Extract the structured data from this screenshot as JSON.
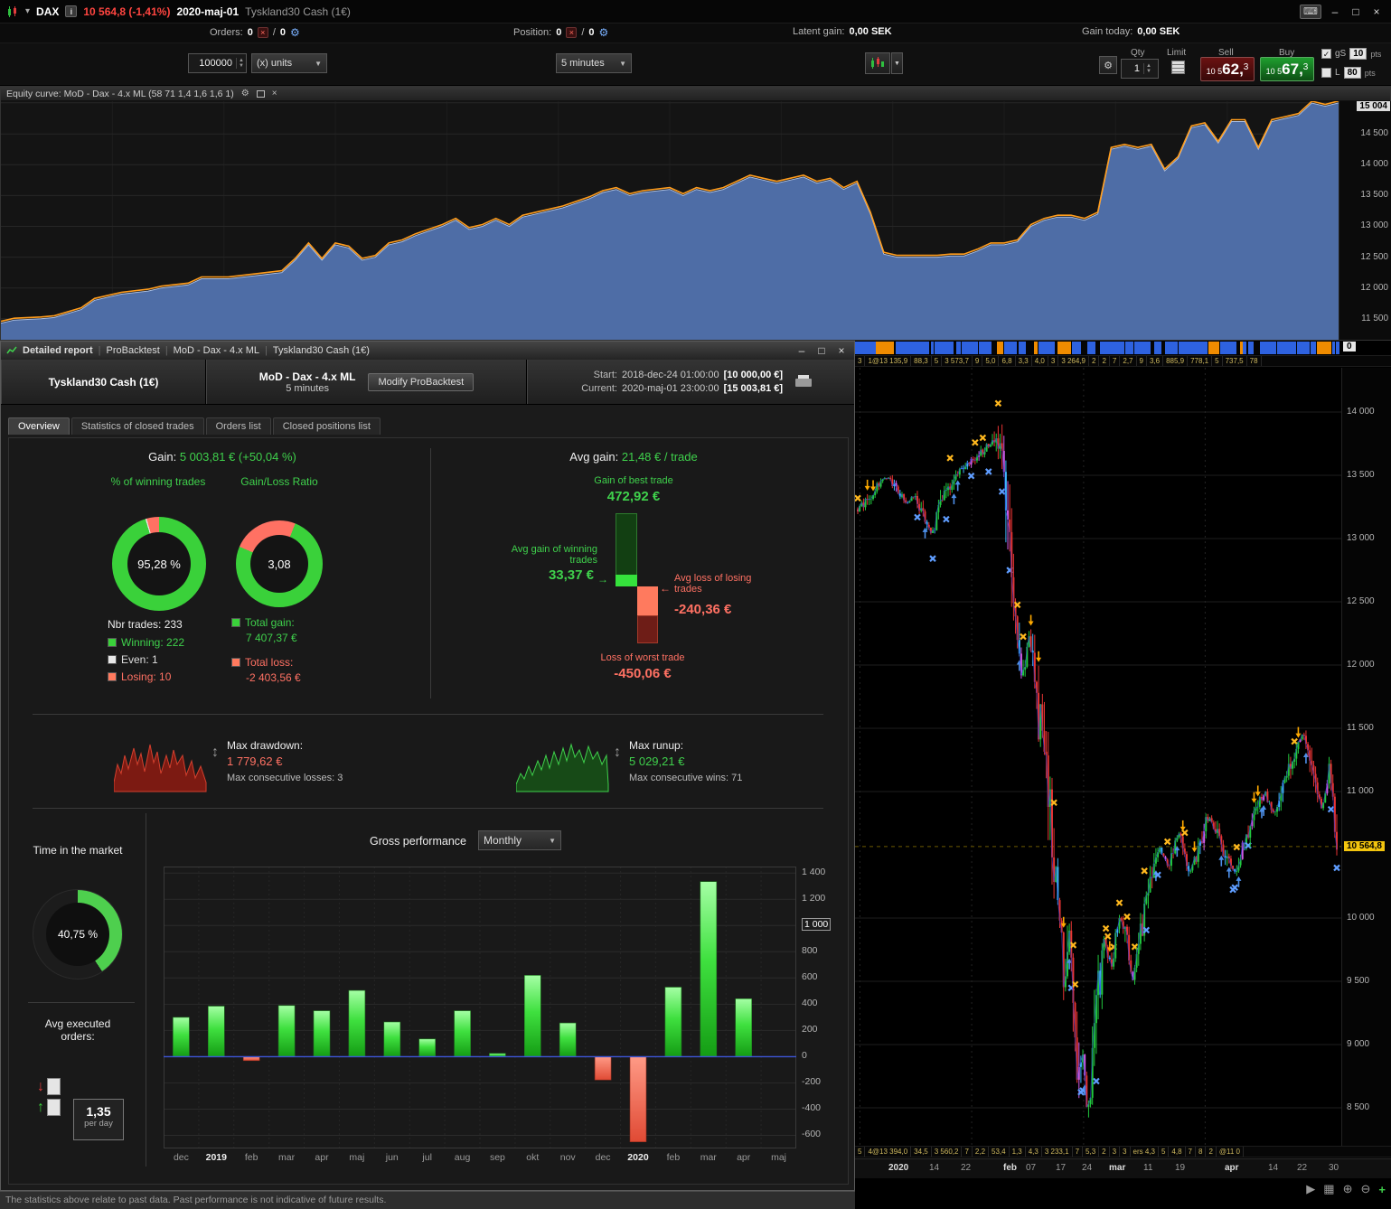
{
  "titlebar": {
    "instrument_short": "DAX",
    "price_change": "10 564,8 (-1,41%)",
    "date": "2020-maj-01",
    "instrument_full": "Tyskland30 Cash (1€)"
  },
  "toolbar": {
    "orders_label": "Orders:",
    "orders_count": "0",
    "orders_count2": "0",
    "position_label": "Position:",
    "position_count": "0",
    "position_count2": "0",
    "latent_gain_label": "Latent gain:",
    "latent_gain_value": "0,00 SEK",
    "gain_today_label": "Gain today:",
    "gain_today_value": "0,00 SEK",
    "units_value": "100000",
    "units_suffix": "(x) units",
    "timeframe": "5 minutes",
    "qty_label": "Qty",
    "qty_value": "1",
    "limit_label": "Limit",
    "sell_label": "Sell",
    "buy_label": "Buy",
    "sell_price_prefix": "10 5",
    "sell_price_main": "62,",
    "sell_price_sup": "3",
    "buy_price_prefix": "10 5",
    "buy_price_main": "67,",
    "buy_price_sup": "3",
    "gs_label": "gS",
    "gs_value": "10",
    "gs_unit": "pts",
    "l_label": "L",
    "l_value": "80",
    "l_unit": "pts"
  },
  "equity_panel": {
    "title": "Equity curve: MoD - Dax - 4.x ML (58 71 1,4 1,6 1,6 1)"
  },
  "report": {
    "window_tabs": [
      "Detailed report",
      "ProBacktest",
      "MoD - Dax - 4.x ML",
      "Tyskland30 Cash (1€)"
    ],
    "header": {
      "instrument": "Tyskland30 Cash (1€)",
      "strategy": "MoD - Dax - 4.x ML",
      "timeframe": "5 minutes",
      "modify_button": "Modify ProBacktest",
      "start_label": "Start:",
      "start_time": "2018-dec-24 01:00:00",
      "start_value": "[10 000,00 €]",
      "current_label": "Current:",
      "current_time": "2020-maj-01 23:00:00",
      "current_value": "[15 003,81 €]"
    },
    "tabs": [
      "Overview",
      "Statistics of closed trades",
      "Orders list",
      "Closed positions list"
    ],
    "active_tab": "Overview",
    "overview": {
      "gain_label": "Gain:",
      "gain_value": "5 003,81 € (+50,04 %)",
      "winning_trades_label": "% of winning trades",
      "winning_trades_pct": "95,28 %",
      "gain_loss_ratio_label": "Gain/Loss Ratio",
      "gain_loss_ratio": "3,08",
      "nbr_trades_label": "Nbr trades:",
      "nbr_trades": "233",
      "winning_label": "Winning:",
      "winning": "222",
      "even_label": "Even:",
      "even": "1",
      "losing_label": "Losing:",
      "losing": "10",
      "total_gain_label": "Total gain:",
      "total_gain": "7 407,37 €",
      "total_loss_label": "Total loss:",
      "total_loss": "-2 403,56 €",
      "avg_gain_label": "Avg gain:",
      "avg_gain": "21,48 € / trade",
      "best_trade_label": "Gain of best trade",
      "best_trade": "472,92 €",
      "avg_win_label": "Avg gain of winning trades",
      "avg_win": "33,37 €",
      "avg_loss_label": "Avg loss of losing trades",
      "avg_loss": "-240,36 €",
      "worst_trade_label": "Loss of worst trade",
      "worst_trade": "-450,06 €",
      "max_drawdown_label": "Max drawdown:",
      "max_drawdown": "1 779,62 €",
      "max_consec_losses": "Max consecutive losses: 3",
      "max_runup_label": "Max runup:",
      "max_runup": "5 029,21 €",
      "max_consec_wins": "Max consecutive wins: 71",
      "time_in_market_label": "Time in the market",
      "time_in_market": "40,75 %",
      "avg_orders_label": "Avg executed orders:",
      "avg_orders": "1,35",
      "avg_orders_unit": "per day",
      "gross_perf_label": "Gross performance",
      "gross_perf_period": "Monthly"
    },
    "status_bar": "The statistics above relate to past data. Past performance is not indicative of future results."
  },
  "price_panel": {
    "current_value_badge": "0",
    "strip_colors": {
      "long": "#2e62e0",
      "signal": "#f08c00"
    },
    "ticker_top": [
      "3",
      "1@13 135,9",
      "88,3",
      "5",
      "3 573,7",
      "9",
      "5,0",
      "6,8",
      "3,3",
      "4,0",
      "3",
      "3 264,9",
      "2",
      "2",
      "7",
      "2,7",
      "9",
      "3,6",
      "885,9",
      "778,1",
      "5",
      "737,5",
      "78"
    ],
    "ticker_bottom": [
      "5",
      "4@13 394,0",
      "34,5",
      "3 560,2",
      "7",
      "2,2",
      "53,4",
      "1,3",
      "4,3",
      "3 233,1",
      "7",
      "5,3",
      "2",
      "3",
      "3",
      "ers 4,3",
      "5",
      "4,8",
      "7",
      "8",
      "2",
      "@11 0"
    ]
  },
  "chart_data": [
    {
      "id": "equity_curve",
      "type": "area",
      "title": "Equity curve: MoD - Dax - 4.x ML (58 71 1,4 1,6 1,6 1)",
      "ylim": [
        11160,
        15030
      ],
      "y_ticks": [
        {
          "label": "15 004",
          "value": 15004,
          "highlight": true
        },
        {
          "label": "14 500",
          "value": 14500
        },
        {
          "label": "14 000",
          "value": 14000
        },
        {
          "label": "13 500",
          "value": 13500
        },
        {
          "label": "13 000",
          "value": 13000
        },
        {
          "label": "12 500",
          "value": 12500
        },
        {
          "label": "12 000",
          "value": 12000
        },
        {
          "label": "11 500",
          "value": 11500
        }
      ],
      "points": [
        [
          0,
          11430
        ],
        [
          1,
          11480
        ],
        [
          3,
          11500
        ],
        [
          4,
          11520
        ],
        [
          6,
          11650
        ],
        [
          7,
          11800
        ],
        [
          9,
          11900
        ],
        [
          11,
          11950
        ],
        [
          12,
          12000
        ],
        [
          14,
          12050
        ],
        [
          15,
          12150
        ],
        [
          17,
          12150
        ],
        [
          19,
          12200
        ],
        [
          21,
          12250
        ],
        [
          22,
          12450
        ],
        [
          23,
          12700
        ],
        [
          24,
          12450
        ],
        [
          25,
          12700
        ],
        [
          26,
          12650
        ],
        [
          27,
          12450
        ],
        [
          28,
          12500
        ],
        [
          29,
          12700
        ],
        [
          30,
          12750
        ],
        [
          31,
          12850
        ],
        [
          33,
          13000
        ],
        [
          34,
          13100
        ],
        [
          35,
          12950
        ],
        [
          36,
          13000
        ],
        [
          37,
          13100
        ],
        [
          38,
          13000
        ],
        [
          39,
          13150
        ],
        [
          40,
          13200
        ],
        [
          42,
          13300
        ],
        [
          44,
          13450
        ],
        [
          45,
          13550
        ],
        [
          46,
          13600
        ],
        [
          47,
          13500
        ],
        [
          48,
          13550
        ],
        [
          50,
          13600
        ],
        [
          51,
          13500
        ],
        [
          52,
          13600
        ],
        [
          53,
          13550
        ],
        [
          54,
          13600
        ],
        [
          55,
          13700
        ],
        [
          56,
          13800
        ],
        [
          57,
          13750
        ],
        [
          58,
          13700
        ],
        [
          59,
          13750
        ],
        [
          60,
          13800
        ],
        [
          61,
          13700
        ],
        [
          62,
          13750
        ],
        [
          63,
          13600
        ],
        [
          64,
          13700
        ],
        [
          65,
          13200
        ],
        [
          66,
          12550
        ],
        [
          67,
          12500
        ],
        [
          68,
          12500
        ],
        [
          70,
          12500
        ],
        [
          71,
          12520
        ],
        [
          72,
          12520
        ],
        [
          73,
          12600
        ],
        [
          74,
          12700
        ],
        [
          75,
          12700
        ],
        [
          76,
          12750
        ],
        [
          77,
          13000
        ],
        [
          78,
          13100
        ],
        [
          79,
          13150
        ],
        [
          80,
          13150
        ],
        [
          81,
          13100
        ],
        [
          82,
          13200
        ],
        [
          83,
          14250
        ],
        [
          84,
          14300
        ],
        [
          85,
          14250
        ],
        [
          86,
          14300
        ],
        [
          87,
          13900
        ],
        [
          88,
          14100
        ],
        [
          89,
          14600
        ],
        [
          90,
          14650
        ],
        [
          91,
          14350
        ],
        [
          92,
          14700
        ],
        [
          93,
          14700
        ],
        [
          94,
          14250
        ],
        [
          95,
          14700
        ],
        [
          96,
          14750
        ],
        [
          97,
          14800
        ],
        [
          98,
          15000
        ],
        [
          99,
          14950
        ],
        [
          100,
          15004
        ]
      ]
    },
    {
      "id": "monthly_performance",
      "type": "bar",
      "title": "Gross performance",
      "period": "Monthly",
      "categories": [
        "dec",
        "2019",
        "feb",
        "mar",
        "apr",
        "maj",
        "jun",
        "jul",
        "aug",
        "sep",
        "okt",
        "nov",
        "dec",
        "2020",
        "feb",
        "mar",
        "apr",
        "maj"
      ],
      "bold_categories": [
        "2019",
        "2020"
      ],
      "values": [
        300,
        385,
        -30,
        390,
        350,
        505,
        265,
        135,
        350,
        25,
        620,
        257,
        -178,
        -650,
        530,
        1335,
        442,
        null
      ],
      "ylim": [
        -700,
        1450
      ],
      "y_ticks": [
        {
          "label": "1 400",
          "value": 1400
        },
        {
          "label": "1 200",
          "value": 1200
        },
        {
          "label": "1 000",
          "value": 1000,
          "highlight": true
        },
        {
          "label": "800",
          "value": 800
        },
        {
          "label": "600",
          "value": 600
        },
        {
          "label": "400",
          "value": 400
        },
        {
          "label": "200",
          "value": 200
        },
        {
          "label": "0",
          "value": 0
        },
        {
          "label": "-200",
          "value": -200
        },
        {
          "label": "-400",
          "value": -400
        },
        {
          "label": "-600",
          "value": -600
        }
      ]
    },
    {
      "id": "price_chart",
      "type": "candlestick",
      "ylim": [
        8200,
        14350
      ],
      "last_price_value": 10564.8,
      "last_price_label": "10 564,8",
      "candle_count": 250,
      "y_ticks": [
        {
          "label": "14 000",
          "value": 14000
        },
        {
          "label": "13 500",
          "value": 13500
        },
        {
          "label": "13 000",
          "value": 13000
        },
        {
          "label": "12 500",
          "value": 12500
        },
        {
          "label": "12 000",
          "value": 12000
        },
        {
          "label": "11 500",
          "value": 11500
        },
        {
          "label": "11 000",
          "value": 11000
        },
        {
          "label": "10 564,8",
          "value": 10564.8,
          "highlight": true
        },
        {
          "label": "10 000",
          "value": 10000
        },
        {
          "label": "9 500",
          "value": 9500
        },
        {
          "label": "9 000",
          "value": 9000
        },
        {
          "label": "8 500",
          "value": 8500
        }
      ],
      "month_x": [
        1,
        24,
        47,
        72
      ],
      "x_ticks": [
        {
          "label": "2020",
          "x": 37,
          "bold": true
        },
        {
          "label": "14",
          "x": 82
        },
        {
          "label": "22",
          "x": 117
        },
        {
          "label": "feb",
          "x": 164,
          "bold": true
        },
        {
          "label": "07",
          "x": 189
        },
        {
          "label": "17",
          "x": 222
        },
        {
          "label": "24",
          "x": 251
        },
        {
          "label": "mar",
          "x": 281,
          "bold": true
        },
        {
          "label": "11",
          "x": 319
        },
        {
          "label": "19",
          "x": 354
        },
        {
          "label": "apr",
          "x": 409,
          "bold": true
        },
        {
          "label": "14",
          "x": 457
        },
        {
          "label": "22",
          "x": 489
        },
        {
          "label": "30",
          "x": 524
        }
      ],
      "anchors": [
        [
          0,
          13230
        ],
        [
          2,
          13300
        ],
        [
          4,
          13420
        ],
        [
          6,
          13480
        ],
        [
          8,
          13400
        ],
        [
          10,
          13280
        ],
        [
          12,
          13340
        ],
        [
          14,
          13160
        ],
        [
          15.5,
          13020
        ],
        [
          17,
          13240
        ],
        [
          19,
          13400
        ],
        [
          21,
          13520
        ],
        [
          23,
          13580
        ],
        [
          25,
          13650
        ],
        [
          27,
          13730
        ],
        [
          28.5,
          13780
        ],
        [
          30,
          13600
        ],
        [
          31.5,
          13050
        ],
        [
          33,
          12400
        ],
        [
          34.5,
          11900
        ],
        [
          36,
          12250
        ],
        [
          37.5,
          11700
        ],
        [
          39,
          11250
        ],
        [
          40.5,
          10700
        ],
        [
          42,
          10150
        ],
        [
          43,
          9550
        ],
        [
          44,
          9950
        ],
        [
          45,
          9200
        ],
        [
          46,
          8650
        ],
        [
          47,
          9000
        ],
        [
          48,
          8400
        ],
        [
          49,
          8800
        ],
        [
          50,
          9350
        ],
        [
          51.5,
          9850
        ],
        [
          53,
          9600
        ],
        [
          54.5,
          10050
        ],
        [
          56,
          9850
        ],
        [
          57.5,
          9500
        ],
        [
          59,
          9850
        ],
        [
          61,
          10250
        ],
        [
          63,
          10550
        ],
        [
          65,
          10400
        ],
        [
          67,
          10700
        ],
        [
          69,
          10350
        ],
        [
          71,
          10500
        ],
        [
          73,
          10800
        ],
        [
          75,
          10700
        ],
        [
          77,
          10450
        ],
        [
          79,
          10350
        ],
        [
          81,
          10650
        ],
        [
          83,
          10850
        ],
        [
          85,
          11000
        ],
        [
          87,
          10800
        ],
        [
          89,
          11050
        ],
        [
          91,
          11300
        ],
        [
          93,
          11450
        ],
        [
          95,
          11150
        ],
        [
          97,
          10850
        ],
        [
          98.5,
          11200
        ],
        [
          100,
          10565
        ]
      ]
    }
  ]
}
